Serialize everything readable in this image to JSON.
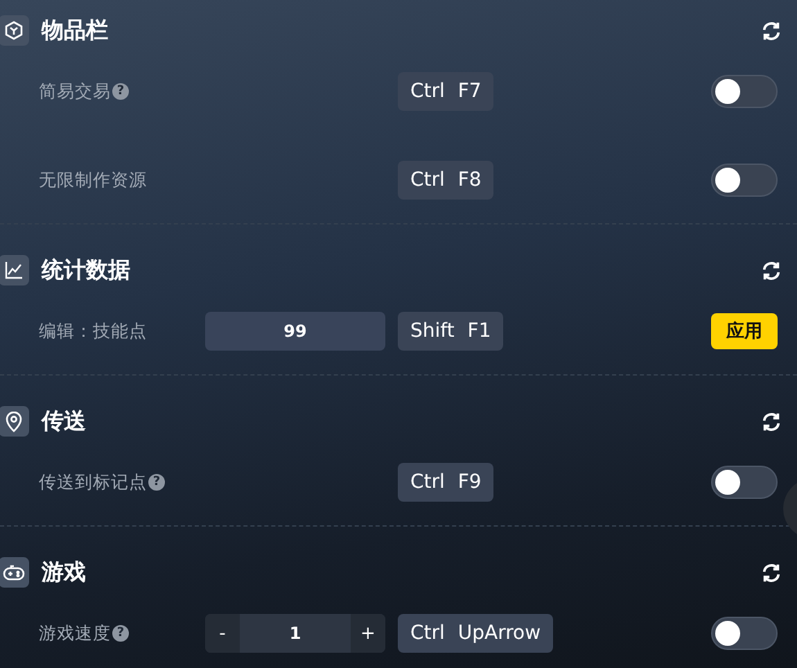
{
  "sections": [
    {
      "title": "物品栏",
      "items": [
        {
          "kind": "toggle",
          "label": "简易交易",
          "help": "?",
          "hotkey": "Ctrl F7",
          "on": false
        },
        {
          "kind": "toggle",
          "label": "无限制作资源",
          "hotkey": "Ctrl F8",
          "on": false
        }
      ]
    },
    {
      "title": "统计数据",
      "items": [
        {
          "kind": "apply",
          "label": "编辑：技能点",
          "value": "99",
          "hotkey": "Shift F1",
          "button": "应用"
        }
      ]
    },
    {
      "title": "传送",
      "items": [
        {
          "kind": "toggle",
          "label": "传送到标记点",
          "help": "?",
          "hotkey": "Ctrl F9",
          "on": false
        }
      ]
    },
    {
      "title": "游戏",
      "items": [
        {
          "kind": "stepper",
          "label": "游戏速度",
          "help": "?",
          "minus": "-",
          "value": "1",
          "plus": "+",
          "hotkey": "Ctrl UpArrow",
          "on": false
        }
      ]
    }
  ]
}
